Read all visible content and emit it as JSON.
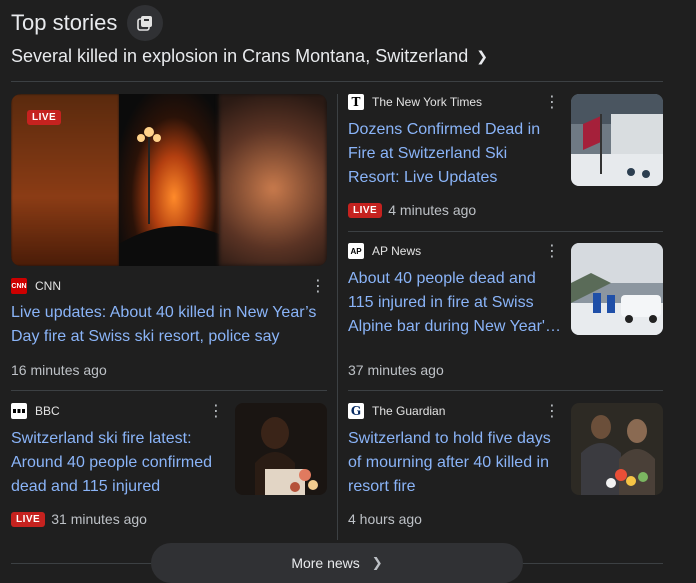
{
  "header": {
    "title": "Top stories",
    "icon": "copy-icon"
  },
  "subheadline": "Several killed in explosion in Crans Montana, Switzerland",
  "live_label": "LIVE",
  "more_news": "More news",
  "colors": {
    "link": "#8ab4f8",
    "live": "#c5221f",
    "background": "#1f1f1f"
  },
  "stories": [
    {
      "source": "CNN",
      "logo_text": "CNN",
      "title": "Live updates: About 40 killed in New Year’s Day fire at Swiss ski resort, police say",
      "time": "16 minutes ago",
      "live": true
    },
    {
      "source": "The New York Times",
      "logo_text": "T",
      "title": "Dozens Confirmed Dead in Fire at Switzerland Ski Resort: Live Updates",
      "time": "4 minutes ago",
      "live": true
    },
    {
      "source": "AP News",
      "logo_text": "AP",
      "title": "About 40 people dead and 115 injured in fire at Swiss Alpine bar during New Year'…",
      "time": "37 minutes ago",
      "live": false
    },
    {
      "source": "BBC",
      "logo_text": "BBC",
      "title": "Switzerland ski fire latest: Around 40 people confirmed dead and 115 injured",
      "time": "31 minutes ago",
      "live": true
    },
    {
      "source": "The Guardian",
      "logo_text": "G",
      "title": "Switzerland to hold five days of mourning after 40 killed in resort fire",
      "time": "4 hours ago",
      "live": false
    }
  ]
}
